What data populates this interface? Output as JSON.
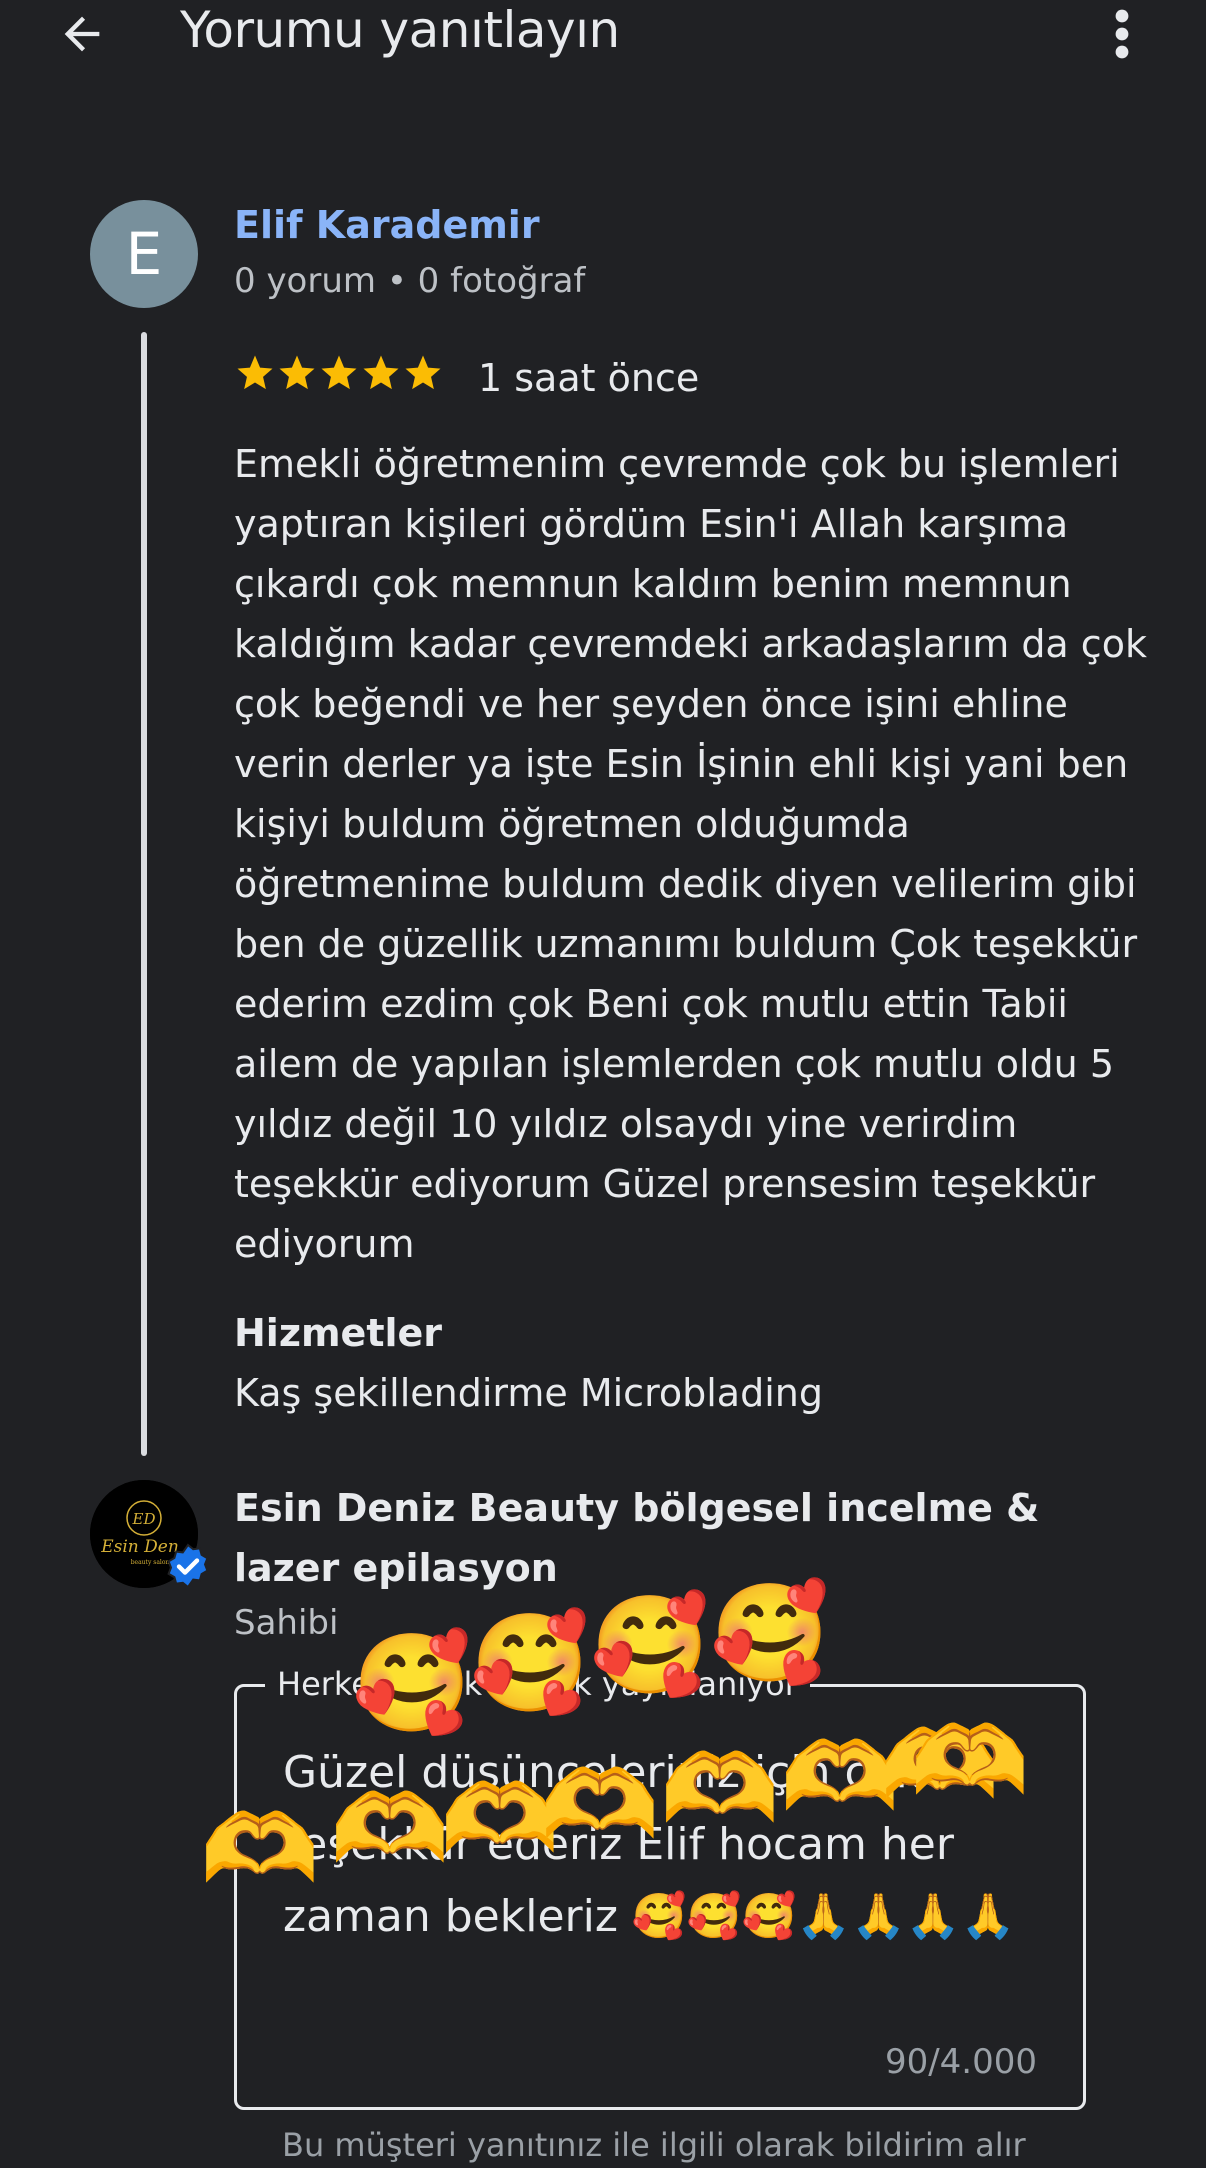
{
  "header": {
    "title": "Yorumu yanıtlayın"
  },
  "review": {
    "avatar_letter": "E",
    "author": "Elif Karademir",
    "stats": "0 yorum • 0 fotoğraf",
    "rating": 5,
    "time": "1 saat önce",
    "text": "Emekli öğretmenim çevremde çok bu işlemleri yaptıran kişileri gördüm Esin'i Allah karşıma çıkardı çok memnun kaldım benim memnun kaldığım kadar çevremdeki arkadaşlarım da çok çok beğendi ve her şeyden önce işini ehline verin derler ya işte Esin İşinin ehli kişi yani ben kişiyi buldum öğretmen olduğumda öğretmenime buldum dedik diyen velilerim gibi ben de güzellik uzmanımı buldum Çok teşekkür ederim ezdim çok Beni çok mutlu ettin Tabii ailem de yapılan işlemlerden çok mutlu oldu 5 yıldız değil 10 yıldız olsaydı yine verirdim teşekkür ediyorum Güzel prensesim teşekkür ediyorum",
    "services_heading": "Hizmetler",
    "services_value": "Kaş şekillendirme Microblading"
  },
  "owner": {
    "name": "Esin Deniz Beauty bölgesel incelme & lazer epilasyon",
    "role": "Sahibi",
    "logo_text": "ED Esin Deniz beauty salon"
  },
  "reply": {
    "label": "Herkese açık olarak yayınlanıyor",
    "text": "Güzel düşünceleriniz için çok teşekkür ederiz Elif hocam her zaman bekleriz 🥰🥰🥰🙏🙏🙏🙏",
    "char_count": "90/4.000",
    "footer_note": "Bu müşteri yanıtınız ile ilgili olarak bildirim alır"
  },
  "overlay": {
    "smiling_faces": [
      "🥰",
      "🥰",
      "🥰",
      "🥰"
    ],
    "heart_hands": [
      "🫶",
      "🫶",
      "🫶",
      "🫶",
      "🫶",
      "🫶",
      "🫶",
      "🫶"
    ]
  },
  "colors": {
    "background": "#202124",
    "link_blue": "#8ab4f8",
    "star_gold": "#fbbc04",
    "avatar_gray": "#78909c",
    "verified_blue": "#1a73e8"
  }
}
